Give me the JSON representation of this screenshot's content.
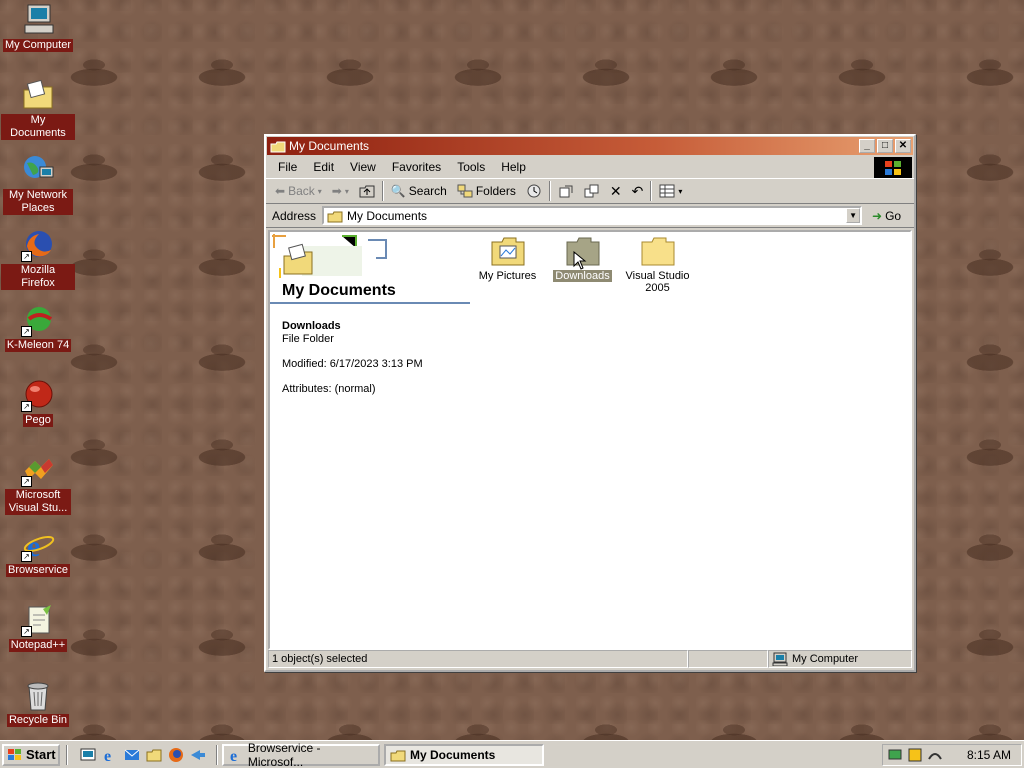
{
  "desktop": {
    "icons": [
      {
        "label": "My Computer",
        "icon": "my-computer-icon"
      },
      {
        "label": "My Documents",
        "icon": "my-documents-icon"
      },
      {
        "label": "My Network Places",
        "icon": "network-places-icon"
      },
      {
        "label": "Mozilla Firefox",
        "icon": "firefox-icon"
      },
      {
        "label": "K-Meleon 74",
        "icon": "k-meleon-icon"
      },
      {
        "label": "Pego",
        "icon": "pego-icon"
      },
      {
        "label": "Microsoft Visual Stu...",
        "icon": "visual-studio-icon"
      },
      {
        "label": "Browservice",
        "icon": "ie-icon"
      },
      {
        "label": "Notepad++",
        "icon": "notepad-plus-plus-icon"
      },
      {
        "label": "Recycle Bin",
        "icon": "recycle-bin-icon"
      }
    ]
  },
  "window": {
    "title": "My Documents",
    "menu": [
      "File",
      "Edit",
      "View",
      "Favorites",
      "Tools",
      "Help"
    ],
    "toolbar": {
      "back": "Back",
      "search": "Search",
      "folders": "Folders"
    },
    "address": {
      "label": "Address",
      "value": "My Documents",
      "go": "Go"
    },
    "left_pane": {
      "title": "My Documents",
      "selected_name": "Downloads",
      "selected_type": "File Folder",
      "modified": "Modified: 6/17/2023 3:13 PM",
      "attributes": "Attributes: (normal)"
    },
    "files": [
      {
        "label": "My Pictures",
        "icon": "pictures-folder-icon",
        "selected": false
      },
      {
        "label": "Downloads",
        "icon": "folder-icon",
        "selected": true
      },
      {
        "label": "Visual Studio 2005",
        "icon": "folder-icon",
        "selected": false
      }
    ],
    "status": {
      "selection": "1 object(s) selected",
      "zone": "My Computer"
    }
  },
  "taskbar": {
    "start": "Start",
    "tasks": [
      {
        "label": "Browservice - Microsof...",
        "active": false
      },
      {
        "label": "My Documents",
        "active": true
      }
    ],
    "clock": "8:15 AM"
  },
  "colors": {
    "title_active": "#8e2010",
    "label_highlight": "#7b1a14",
    "selection": "#8e8a72"
  }
}
